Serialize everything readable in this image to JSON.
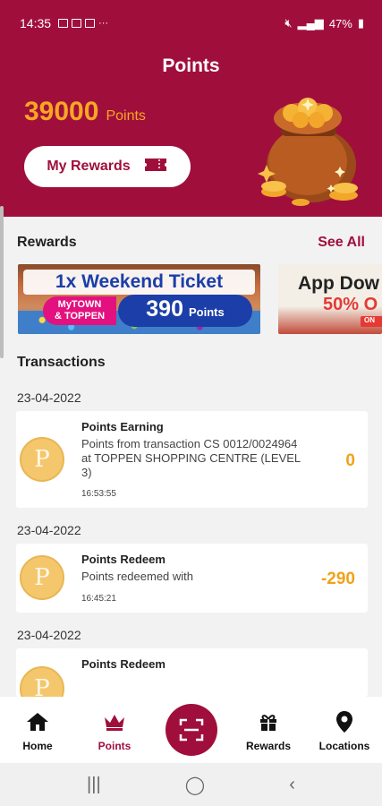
{
  "status_bar": {
    "time": "14:35",
    "battery": "47%"
  },
  "header": {
    "title": "Points",
    "points_value": "39000",
    "points_unit": "Points",
    "my_rewards_label": "My Rewards"
  },
  "rewards": {
    "title": "Rewards",
    "see_all": "See All",
    "banners": [
      {
        "headline": "1x Weekend Ticket",
        "brand_line1": "MyTOWN",
        "brand_line2": "& TOPPEN",
        "price": "390",
        "price_unit": "Points"
      },
      {
        "headline": "App Dow",
        "discount": "50% O",
        "tag": "ON"
      }
    ]
  },
  "transactions": {
    "title": "Transactions",
    "items": [
      {
        "date": "23-04-2022",
        "title": "Points Earning",
        "description": "Points from transaction CS 0012/0024964 at TOPPEN SHOPPING CENTRE (LEVEL 3)",
        "time": "16:53:55",
        "amount": "0"
      },
      {
        "date": "23-04-2022",
        "title": "Points Redeem",
        "description": "Points redeemed with",
        "time": "16:45:21",
        "amount": "-290"
      },
      {
        "date": "23-04-2022",
        "title": "Points Redeem",
        "description": "",
        "time": "",
        "amount": ""
      }
    ],
    "coin_glyph": "P"
  },
  "bottom_nav": {
    "items": [
      {
        "label": "Home",
        "icon": "home-icon"
      },
      {
        "label": "Points",
        "icon": "crown-icon"
      },
      {
        "label": "Rewards",
        "icon": "gift-icon"
      },
      {
        "label": "Locations",
        "icon": "location-pin-icon"
      }
    ],
    "active": "Points"
  },
  "colors": {
    "brand": "#a00f3c",
    "accent": "#f7a623"
  }
}
